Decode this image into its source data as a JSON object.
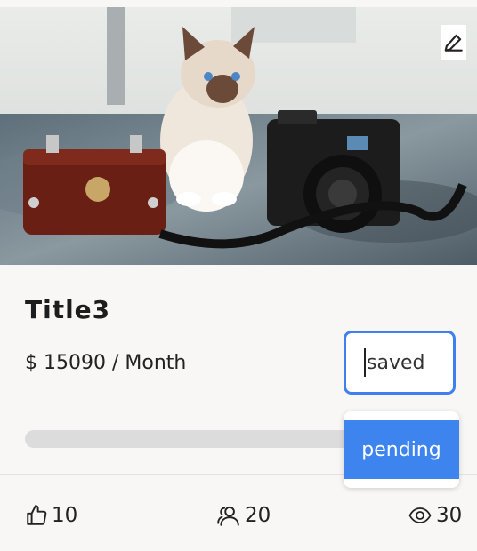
{
  "card": {
    "title": "Title3",
    "price": "$ 15090 / Month",
    "status_value": "saved",
    "status_options": [
      "pending"
    ],
    "progress": 0
  },
  "stats": {
    "likes": "10",
    "members": "20",
    "views": "30"
  },
  "icons": {
    "edit": "pencil-icon",
    "likes": "thumbs-up-icon",
    "members": "users-icon",
    "views": "eye-icon"
  },
  "colors": {
    "accent": "#3d84ee",
    "progress_track": "#dcdcdc"
  }
}
